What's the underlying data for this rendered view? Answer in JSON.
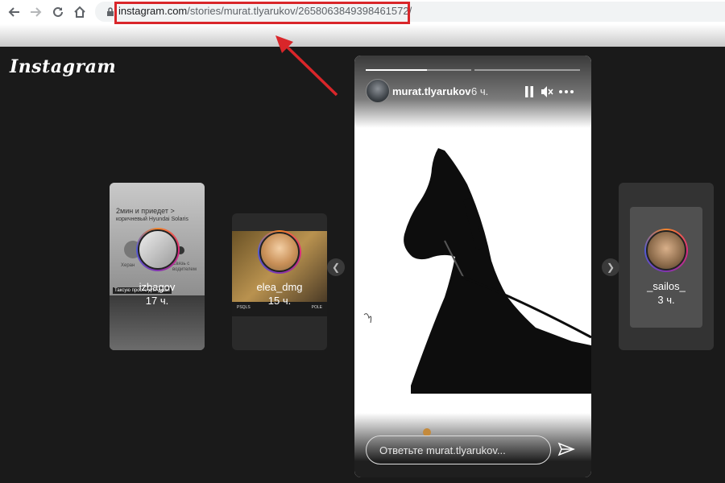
{
  "browser": {
    "url_host": "instagram.com",
    "url_path": "/stories/murat.tlyarukov/2658063849398461572/"
  },
  "app": {
    "logo": "Instagram"
  },
  "thumbs": [
    {
      "username": "izbagov",
      "age": "17 ч.",
      "preview_line1": "2мин и приедет >",
      "preview_line2": "коричневый Hyundai Solaris",
      "preview_left": "Херан",
      "preview_right": "Связь с водителем",
      "preview_caption": "Таксую просто для души"
    },
    {
      "username": "elea_dmg",
      "age": "15 ч.",
      "caption_left": "PSQLS",
      "caption_right": "POLE"
    },
    {
      "username": "_sailos_",
      "age": "3 ч."
    }
  ],
  "story": {
    "username": "murat.tlyarukov",
    "age": "6 ч.",
    "progress": [
      1.0,
      0.0
    ],
    "reply_placeholder": "Ответьте murat.tlyarukov..."
  }
}
